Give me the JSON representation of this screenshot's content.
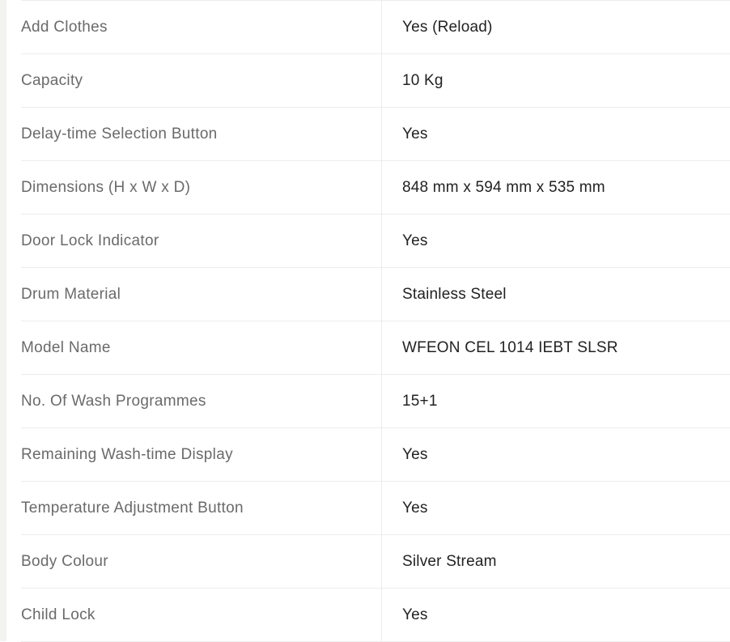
{
  "specifications": [
    {
      "label": "Add Clothes",
      "value": "Yes (Reload)"
    },
    {
      "label": "Capacity",
      "value": "10 Kg"
    },
    {
      "label": "Delay-time Selection Button",
      "value": "Yes"
    },
    {
      "label": "Dimensions (H x W x D)",
      "value": "848 mm x 594 mm x 535 mm"
    },
    {
      "label": "Door Lock Indicator",
      "value": "Yes"
    },
    {
      "label": "Drum Material",
      "value": "Stainless Steel"
    },
    {
      "label": "Model Name",
      "value": "WFEON CEL 1014 IEBT SLSR"
    },
    {
      "label": "No. Of Wash Programmes",
      "value": "15+1"
    },
    {
      "label": "Remaining Wash-time Display",
      "value": "Yes"
    },
    {
      "label": "Temperature Adjustment Button",
      "value": "Yes"
    },
    {
      "label": "Body Colour",
      "value": "Silver Stream"
    },
    {
      "label": "Child Lock",
      "value": "Yes"
    }
  ]
}
